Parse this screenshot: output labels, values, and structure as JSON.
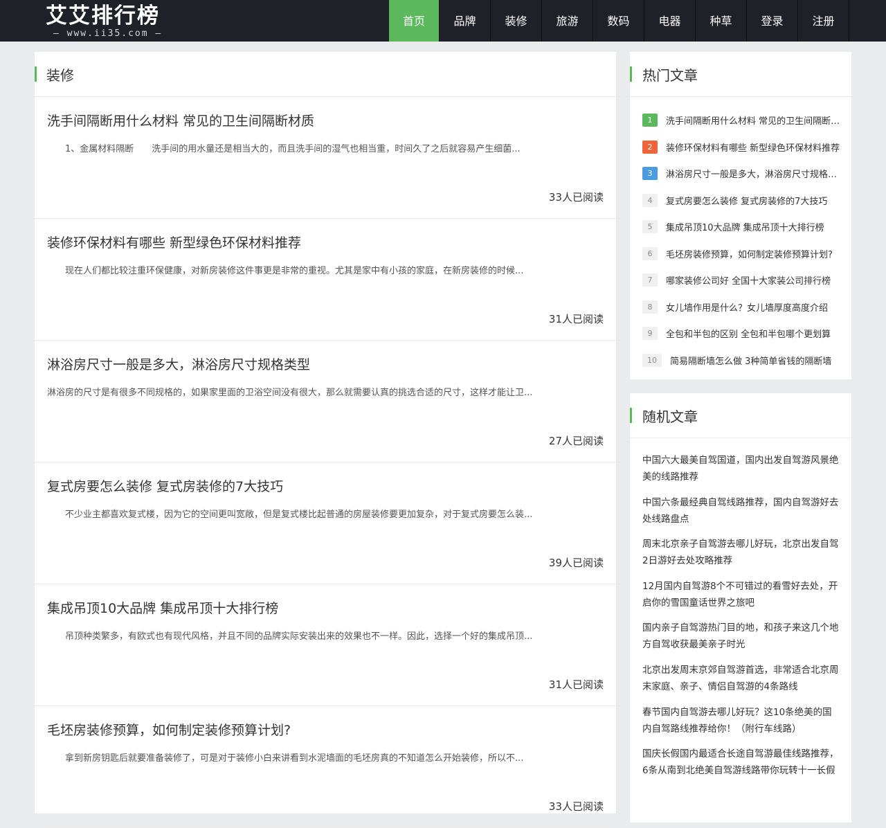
{
  "header": {
    "logo_main": "艾艾排行榜",
    "logo_sub": "— www.ii35.com —",
    "nav": [
      {
        "label": "首页",
        "active": true
      },
      {
        "label": "品牌"
      },
      {
        "label": "装修"
      },
      {
        "label": "旅游"
      },
      {
        "label": "数码"
      },
      {
        "label": "电器"
      },
      {
        "label": "种草"
      },
      {
        "label": "登录"
      },
      {
        "label": "注册"
      }
    ]
  },
  "main": {
    "section_title": "装修",
    "articles": [
      {
        "title": "洗手间隔断用什么材料 常见的卫生间隔断材质",
        "summary": "　　1、金属材料隔断　　洗手间的用水量还是相当大的，而且洗手间的湿气也相当重，时间久了之后就容易产生细菌...",
        "reads": "33人已阅读"
      },
      {
        "title": "装修环保材料有哪些 新型绿色环保材料推荐",
        "summary": "　　现在人们都比较注重环保健康，对新房装修这件事更是非常的重视。尤其是家中有小孩的家庭，在新房装修的时候...",
        "reads": "31人已阅读"
      },
      {
        "title": "淋浴房尺寸一般是多大，淋浴房尺寸规格类型",
        "summary": "淋浴房的尺寸是有很多不同规格的，如果家里面的卫浴空间没有很大，那么就需要认真的挑选合适的尺寸，这样才能让卫...",
        "reads": "27人已阅读"
      },
      {
        "title": "复式房要怎么装修 复式房装修的7大技巧",
        "summary": "　　不少业主都喜欢复式楼，因为它的空间更叫宽敞，但是复式楼比起普通的房屋装修要更加复杂，对于复式房要怎么装...",
        "reads": "39人已阅读"
      },
      {
        "title": "集成吊顶10大品牌 集成吊顶十大排行榜",
        "summary": "　　吊顶种类繁多，有欧式也有现代风格，并且不同的品牌实际安装出来的效果也不一样。因此，选择一个好的集成吊顶...",
        "reads": "31人已阅读"
      },
      {
        "title": "毛坯房装修预算，如何制定装修预算计划?",
        "summary": "　　拿到新房钥匙后就要准备装修了，可是对于装修小白来讲看到水泥墙面的毛坯房真的不知道怎么开始装修，所以不...",
        "reads": "33人已阅读"
      }
    ]
  },
  "hot": {
    "title": "热门文章",
    "items": [
      {
        "rank": "1",
        "text": "洗手间隔断用什么材料 常见的卫生间隔断材质"
      },
      {
        "rank": "2",
        "text": "装修环保材料有哪些 新型绿色环保材料推荐"
      },
      {
        "rank": "3",
        "text": "淋浴房尺寸一般是多大，淋浴房尺寸规格类型"
      },
      {
        "rank": "4",
        "text": "复式房要怎么装修 复式房装修的7大技巧"
      },
      {
        "rank": "5",
        "text": "集成吊顶10大品牌 集成吊顶十大排行榜"
      },
      {
        "rank": "6",
        "text": "毛坯房装修预算，如何制定装修预算计划?"
      },
      {
        "rank": "7",
        "text": "哪家装修公司好 全国十大家装公司排行榜"
      },
      {
        "rank": "8",
        "text": "女儿墙作用是什么？女儿墙厚度高度介绍"
      },
      {
        "rank": "9",
        "text": "全包和半包的区别 全包和半包哪个更划算"
      },
      {
        "rank": "10",
        "text": "简易隔断墙怎么做 3种简单省钱的隔断墙"
      }
    ]
  },
  "random": {
    "title": "随机文章",
    "items": [
      "中国六大最美自驾国道，国内出发自驾游风景绝美的线路推荐",
      "中国六条最经典自驾线路推荐，国内自驾游好去处线路盘点",
      "周末北京亲子自驾游去哪儿好玩，北京出发自驾2日游好去处攻略推荐",
      "12月国内自驾游8个不可错过的看雪好去处，开启你的雪国童话世界之旅吧",
      "国内亲子自驾游热门目的地，和孩子来这几个地方自驾收获最美亲子时光",
      "北京出发周末京郊自驾游首选，非常适合北京周末家庭、亲子、情侣自驾游的4条路线",
      "春节国内自驾游去哪儿好玩？这10条绝美的国内自驾路线推荐给你！（附行车线路）",
      "国庆长假国内最适合长途自驾游最佳线路推荐，6条从南到北绝美自驾游线路带你玩转十一长假"
    ]
  },
  "colors": {
    "accent": "#5cb85c",
    "header_bg": "#1e2128",
    "rank2": "#f0643c",
    "rank3": "#4a9be0"
  }
}
